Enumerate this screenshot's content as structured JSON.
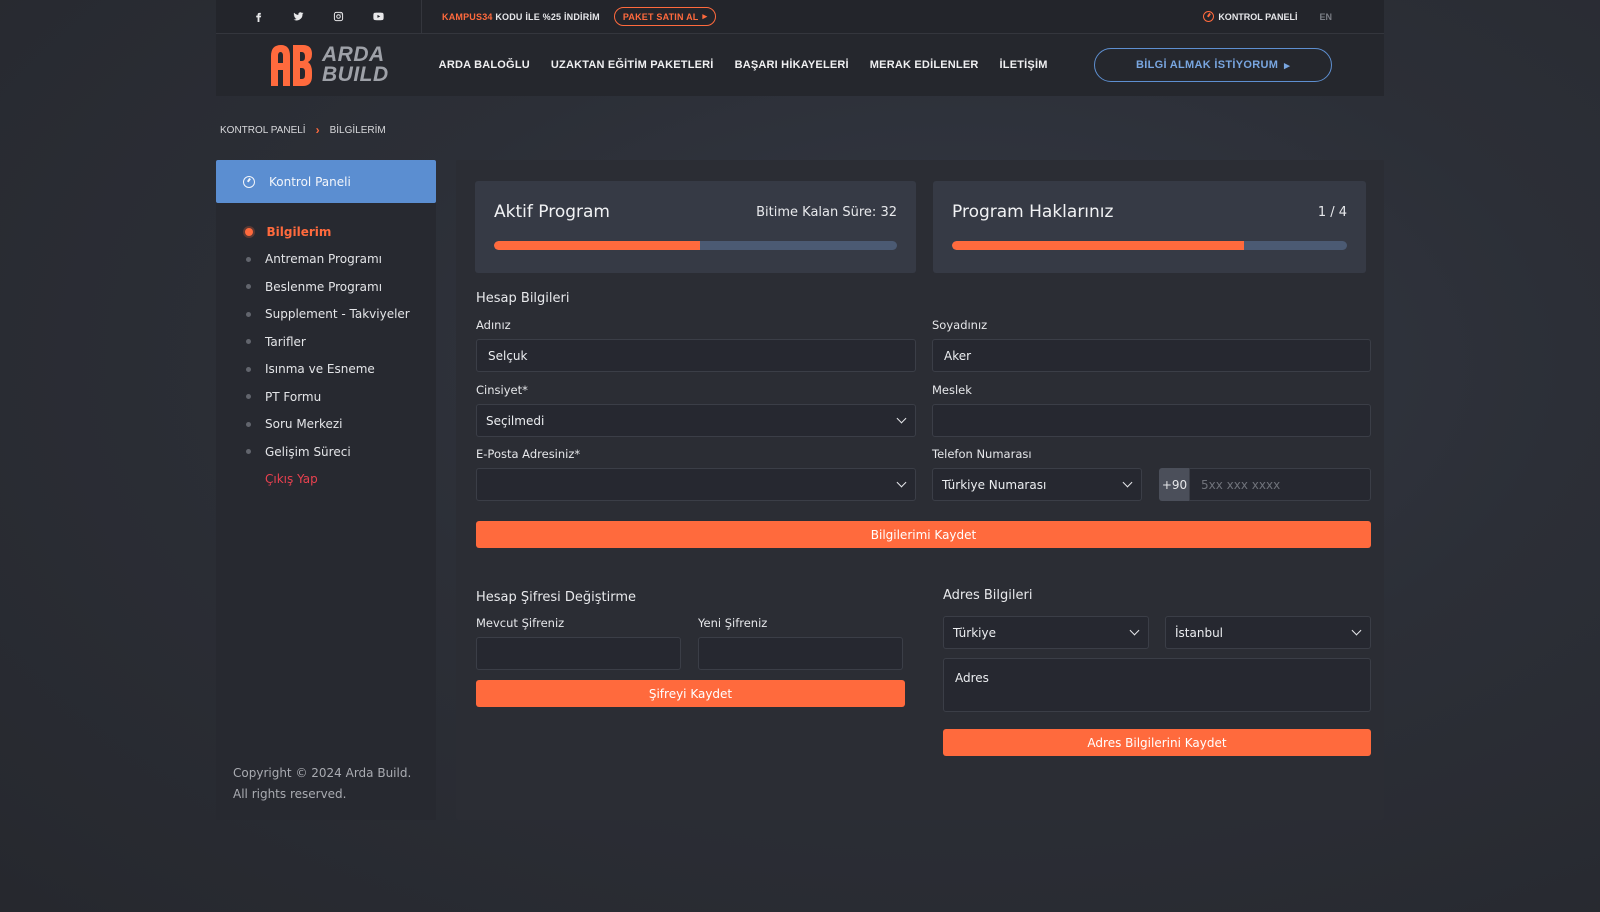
{
  "topbar": {
    "social_icons": [
      "facebook-icon",
      "twitter-icon",
      "instagram-icon",
      "youtube-icon"
    ],
    "promo_code": "KAMPUS34",
    "promo_text": "KODU İLE %25 İNDİRİM",
    "promo_button": "PAKET SATIN AL",
    "dashboard_link": "KONTROL PANELİ",
    "lang": "EN"
  },
  "nav": {
    "logo_line1": "ARDA",
    "logo_line2": "BUILD",
    "items": [
      "ARDA BALOĞLU",
      "UZAKTAN EĞİTİM PAKETLERİ",
      "BAŞARI HİKAYELERİ",
      "MERAK EDİLENLER",
      "İLETİŞİM"
    ],
    "cta": "BİLGİ ALMAK İSTİYORUM"
  },
  "breadcrumb": {
    "root": "KONTROL PANELİ",
    "current": "BİLGİLERİM"
  },
  "sidebar": {
    "header": "Kontrol Paneli",
    "items": [
      "Bilgilerim",
      "Antreman Programı",
      "Beslenme Programı",
      "Supplement - Takviyeler",
      "Tarifler",
      "Isınma ve Esneme",
      "PT Formu",
      "Soru Merkezi",
      "Gelişim Süreci"
    ],
    "logout": "Çıkış Yap",
    "copyright_line1": "Copyright © 2024 Arda Build.",
    "copyright_line2": "All rights reserved."
  },
  "program_card": {
    "title": "Aktif Program",
    "remaining": "Bitime Kalan Süre: 32",
    "progress": 0.51
  },
  "rights_card": {
    "title": "Program Haklarınız",
    "value": "1 / 4",
    "progress": 0.74
  },
  "account": {
    "title": "Hesap Bilgileri",
    "first_name_label": "Adınız",
    "first_name": "Selçuk",
    "last_name_label": "Soyadınız",
    "last_name": "Aker",
    "gender_label": "Cinsiyet*",
    "gender": "Seçilmedi",
    "job_label": "Meslek",
    "job": "",
    "email_label": "E-Posta Adresiniz*",
    "email": "",
    "phone_label": "Telefon Numarası",
    "phone_type": "Türkiye Numarası",
    "phone_prefix": "+90",
    "phone_placeholder": "5xx xxx xxxx",
    "save": "Bilgilerimi Kaydet"
  },
  "password": {
    "title": "Hesap Şifresi Değiştirme",
    "current_label": "Mevcut Şifreniz",
    "new_label": "Yeni Şifreniz",
    "save": "Şifreyi Kaydet"
  },
  "address": {
    "title": "Adres Bilgileri",
    "country": "Türkiye",
    "city": "İstanbul",
    "address_placeholder": "Adres",
    "save": "Adres Bilgilerini Kaydet"
  },
  "colors": {
    "accent": "#ff6a3d",
    "blue": "#5b8ed1",
    "danger": "#e8414f"
  }
}
